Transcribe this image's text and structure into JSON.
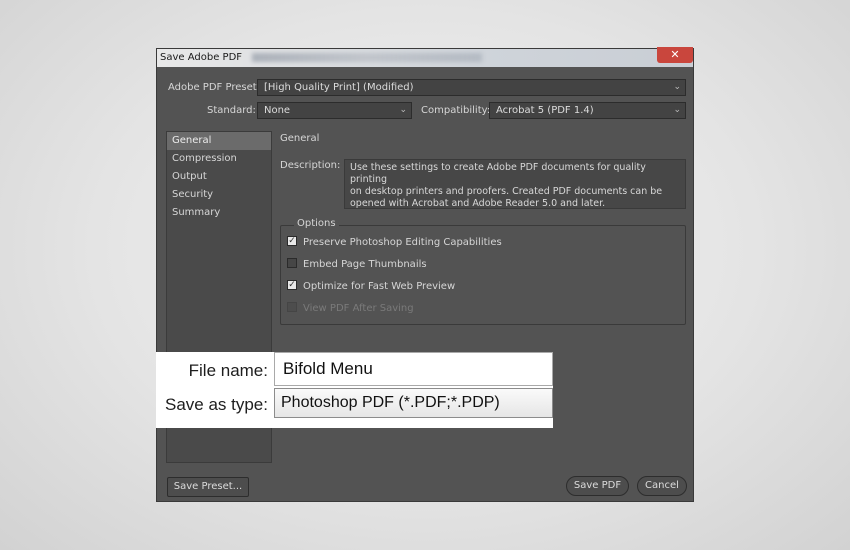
{
  "window": {
    "title": "Save Adobe PDF",
    "close_symbol": "✕"
  },
  "preset": {
    "label": "Adobe PDF Preset:",
    "value": "[High Quality Print] (Modified)"
  },
  "standard": {
    "label": "Standard:",
    "value": "None"
  },
  "compatibility": {
    "label": "Compatibility:",
    "value": "Acrobat 5 (PDF 1.4)"
  },
  "sidebar": {
    "items": [
      {
        "label": "General",
        "active": true
      },
      {
        "label": "Compression",
        "active": false
      },
      {
        "label": "Output",
        "active": false
      },
      {
        "label": "Security",
        "active": false
      },
      {
        "label": "Summary",
        "active": false
      }
    ]
  },
  "section": {
    "title": "General"
  },
  "description": {
    "label": "Description:",
    "line1": "Use these settings to create Adobe PDF documents for quality printing",
    "line2": "on desktop printers and proofers.  Created PDF documents can be",
    "line3": "opened with Acrobat and Adobe Reader 5.0 and later."
  },
  "options": {
    "legend": "Options",
    "items": [
      {
        "label": "Preserve Photoshop Editing Capabilities",
        "checked": true,
        "enabled": true
      },
      {
        "label": "Embed Page Thumbnails",
        "checked": false,
        "enabled": true
      },
      {
        "label": "Optimize for Fast Web Preview",
        "checked": true,
        "enabled": true
      },
      {
        "label": "View PDF After Saving",
        "checked": false,
        "enabled": false
      }
    ]
  },
  "file_overlay": {
    "filename_label": "File name:",
    "filename_value": "Bifold Menu",
    "type_label": "Save as type:",
    "type_value": "Photoshop PDF (*.PDF;*.PDP)"
  },
  "buttons": {
    "save_preset": "Save Preset...",
    "save_pdf": "Save PDF",
    "cancel": "Cancel"
  },
  "colors": {
    "dialog_bg": "#535353",
    "close_button": "#c9463d",
    "active_item": "#6b6b6b"
  }
}
